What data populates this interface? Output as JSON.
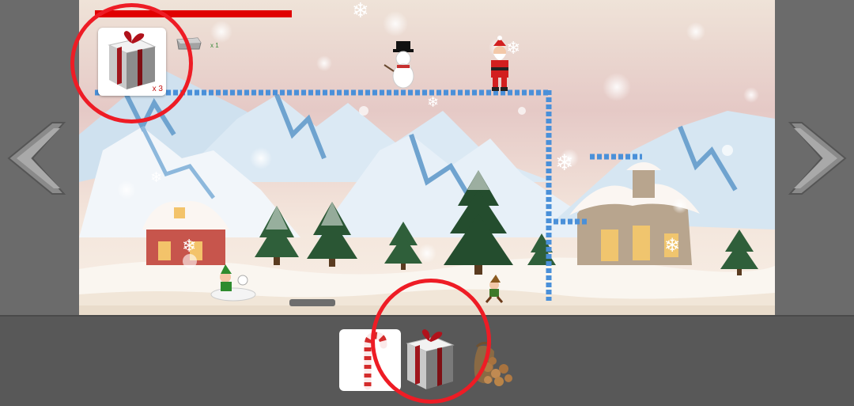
{
  "hud": {
    "health_fraction": 1.0,
    "selected_item_icon": "gift-box-icon",
    "selected_item_count": "x 3",
    "secondary_item_icon": "stone-block-icon",
    "secondary_item_count": "x 1"
  },
  "navigation": {
    "prev_icon": "chevron-left-icon",
    "next_icon": "chevron-right-icon"
  },
  "toolbar": {
    "items": [
      {
        "icon": "candy-cane-icon",
        "selected": true
      },
      {
        "icon": "gift-box-icon",
        "selected": false
      },
      {
        "icon": "nut-sack-icon",
        "selected": false
      }
    ]
  },
  "scene": {
    "characters": [
      "snowman",
      "santa",
      "elf-player",
      "elf-enemy"
    ],
    "colors": {
      "health": "#e00000",
      "highlight_ring": "#ee1c25",
      "platform": "#4a90d9"
    }
  }
}
